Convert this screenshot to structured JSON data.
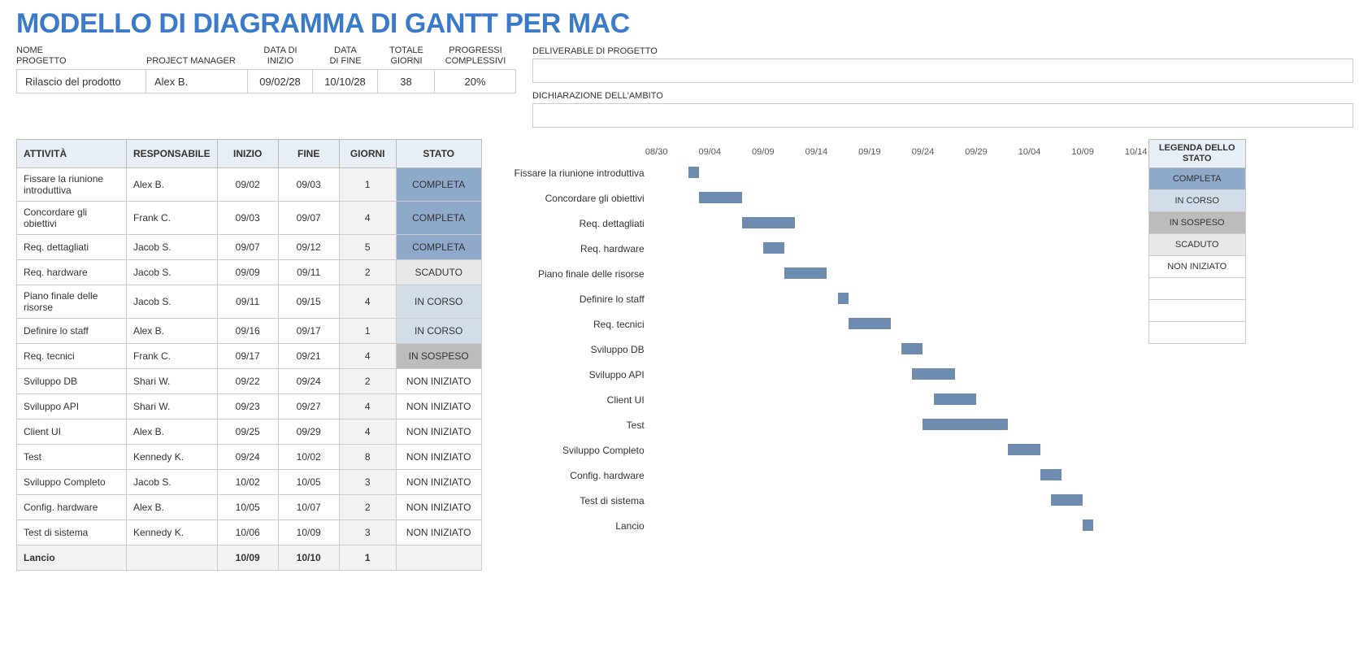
{
  "title": "MODELLO DI DIAGRAMMA DI GANTT PER MAC",
  "summary_headers": {
    "name": "NOME\nPROGETTO",
    "pm": "PROJECT MANAGER",
    "start": "DATA DI\nINIZIO",
    "end": "DATA\nDI FINE",
    "days": "TOTALE\nGIORNI",
    "progress": "PROGRESSI\nCOMPLESSIVI"
  },
  "summary": {
    "name": "Rilascio del prodotto",
    "pm": "Alex B.",
    "start": "09/02/28",
    "end": "10/10/28",
    "days": "38",
    "progress": "20%"
  },
  "deliverable_label": "DELIVERABLE DI PROGETTO",
  "scope_label": "DICHIARAZIONE DELL'AMBITO",
  "table_headers": {
    "activity": "ATTIVITÀ",
    "owner": "RESPONSABILE",
    "start": "INIZIO",
    "end": "FINE",
    "days": "GIORNI",
    "status": "STATO"
  },
  "tasks": [
    {
      "name": "Fissare la riunione introduttiva",
      "owner": "Alex B.",
      "start": "09/02",
      "end": "09/03",
      "days": "1",
      "status": "COMPLETA",
      "status_class": "st-completa"
    },
    {
      "name": "Concordare gli obiettivi",
      "owner": "Frank C.",
      "start": "09/03",
      "end": "09/07",
      "days": "4",
      "status": "COMPLETA",
      "status_class": "st-completa"
    },
    {
      "name": "Req. dettagliati",
      "owner": "Jacob S.",
      "start": "09/07",
      "end": "09/12",
      "days": "5",
      "status": "COMPLETA",
      "status_class": "st-completa"
    },
    {
      "name": "Req. hardware",
      "owner": "Jacob S.",
      "start": "09/09",
      "end": "09/11",
      "days": "2",
      "status": "SCADUTO",
      "status_class": "st-scaduto"
    },
    {
      "name": "Piano finale delle risorse",
      "owner": "Jacob S.",
      "start": "09/11",
      "end": "09/15",
      "days": "4",
      "status": "IN CORSO",
      "status_class": "st-incorso"
    },
    {
      "name": "Definire lo staff",
      "owner": "Alex B.",
      "start": "09/16",
      "end": "09/17",
      "days": "1",
      "status": "IN CORSO",
      "status_class": "st-incorso"
    },
    {
      "name": "Req. tecnici",
      "owner": "Frank C.",
      "start": "09/17",
      "end": "09/21",
      "days": "4",
      "status": "IN SOSPESO",
      "status_class": "st-insospeso"
    },
    {
      "name": "Sviluppo DB",
      "owner": "Shari W.",
      "start": "09/22",
      "end": "09/24",
      "days": "2",
      "status": "NON INIZIATO",
      "status_class": "st-noniniziato"
    },
    {
      "name": "Sviluppo API",
      "owner": "Shari W.",
      "start": "09/23",
      "end": "09/27",
      "days": "4",
      "status": "NON INIZIATO",
      "status_class": "st-noniniziato"
    },
    {
      "name": "Client UI",
      "owner": "Alex B.",
      "start": "09/25",
      "end": "09/29",
      "days": "4",
      "status": "NON INIZIATO",
      "status_class": "st-noniniziato"
    },
    {
      "name": "Test",
      "owner": "Kennedy K.",
      "start": "09/24",
      "end": "10/02",
      "days": "8",
      "status": "NON INIZIATO",
      "status_class": "st-noniniziato"
    },
    {
      "name": "Sviluppo Completo",
      "owner": "Jacob S.",
      "start": "10/02",
      "end": "10/05",
      "days": "3",
      "status": "NON INIZIATO",
      "status_class": "st-noniniziato"
    },
    {
      "name": "Config. hardware",
      "owner": "Alex B.",
      "start": "10/05",
      "end": "10/07",
      "days": "2",
      "status": "NON INIZIATO",
      "status_class": "st-noniniziato"
    },
    {
      "name": "Test di sistema",
      "owner": "Kennedy K.",
      "start": "10/06",
      "end": "10/09",
      "days": "3",
      "status": "NON INIZIATO",
      "status_class": "st-noniniziato"
    },
    {
      "name": "Lancio",
      "owner": "",
      "start": "10/09",
      "end": "10/10",
      "days": "1",
      "status": "",
      "status_class": "st-noniniziato",
      "bold": true
    }
  ],
  "legend": {
    "title": "LEGENDA DELLO STATO",
    "items": [
      {
        "label": "COMPLETA",
        "class": "st-completa"
      },
      {
        "label": "IN CORSO",
        "class": "st-incorso"
      },
      {
        "label": "IN SOSPESO",
        "class": "st-insospeso"
      },
      {
        "label": "SCADUTO",
        "class": "st-scaduto"
      },
      {
        "label": "NON INIZIATO",
        "class": "st-noniniziato"
      },
      {
        "label": "",
        "class": "st-noniniziato"
      },
      {
        "label": "",
        "class": "st-noniniziato"
      },
      {
        "label": "",
        "class": "st-noniniziato"
      }
    ]
  },
  "chart_data": {
    "type": "bar",
    "orientation": "horizontal",
    "title": "",
    "x_axis": {
      "min_day": 0,
      "max_day": 45,
      "origin_label": "08/30",
      "ticks": [
        {
          "label": "08/30",
          "day": 0
        },
        {
          "label": "09/04",
          "day": 5
        },
        {
          "label": "09/09",
          "day": 10
        },
        {
          "label": "09/14",
          "day": 15
        },
        {
          "label": "09/19",
          "day": 20
        },
        {
          "label": "09/24",
          "day": 25
        },
        {
          "label": "09/29",
          "day": 30
        },
        {
          "label": "10/04",
          "day": 35
        },
        {
          "label": "10/09",
          "day": 40
        },
        {
          "label": "10/14",
          "day": 45
        }
      ]
    },
    "series": [
      {
        "name": "Fissare la riunione introduttiva",
        "start_day": 3,
        "duration": 1
      },
      {
        "name": "Concordare gli obiettivi",
        "start_day": 4,
        "duration": 4
      },
      {
        "name": "Req. dettagliati",
        "start_day": 8,
        "duration": 5
      },
      {
        "name": "Req. hardware",
        "start_day": 10,
        "duration": 2
      },
      {
        "name": "Piano finale delle risorse",
        "start_day": 12,
        "duration": 4
      },
      {
        "name": "Definire lo staff",
        "start_day": 17,
        "duration": 1
      },
      {
        "name": "Req. tecnici",
        "start_day": 18,
        "duration": 4
      },
      {
        "name": "Sviluppo DB",
        "start_day": 23,
        "duration": 2
      },
      {
        "name": "Sviluppo API",
        "start_day": 24,
        "duration": 4
      },
      {
        "name": "Client UI",
        "start_day": 26,
        "duration": 4
      },
      {
        "name": "Test",
        "start_day": 25,
        "duration": 8
      },
      {
        "name": "Sviluppo Completo",
        "start_day": 33,
        "duration": 3
      },
      {
        "name": "Config. hardware",
        "start_day": 36,
        "duration": 2
      },
      {
        "name": "Test di sistema",
        "start_day": 37,
        "duration": 3
      },
      {
        "name": "Lancio",
        "start_day": 40,
        "duration": 1
      }
    ]
  }
}
